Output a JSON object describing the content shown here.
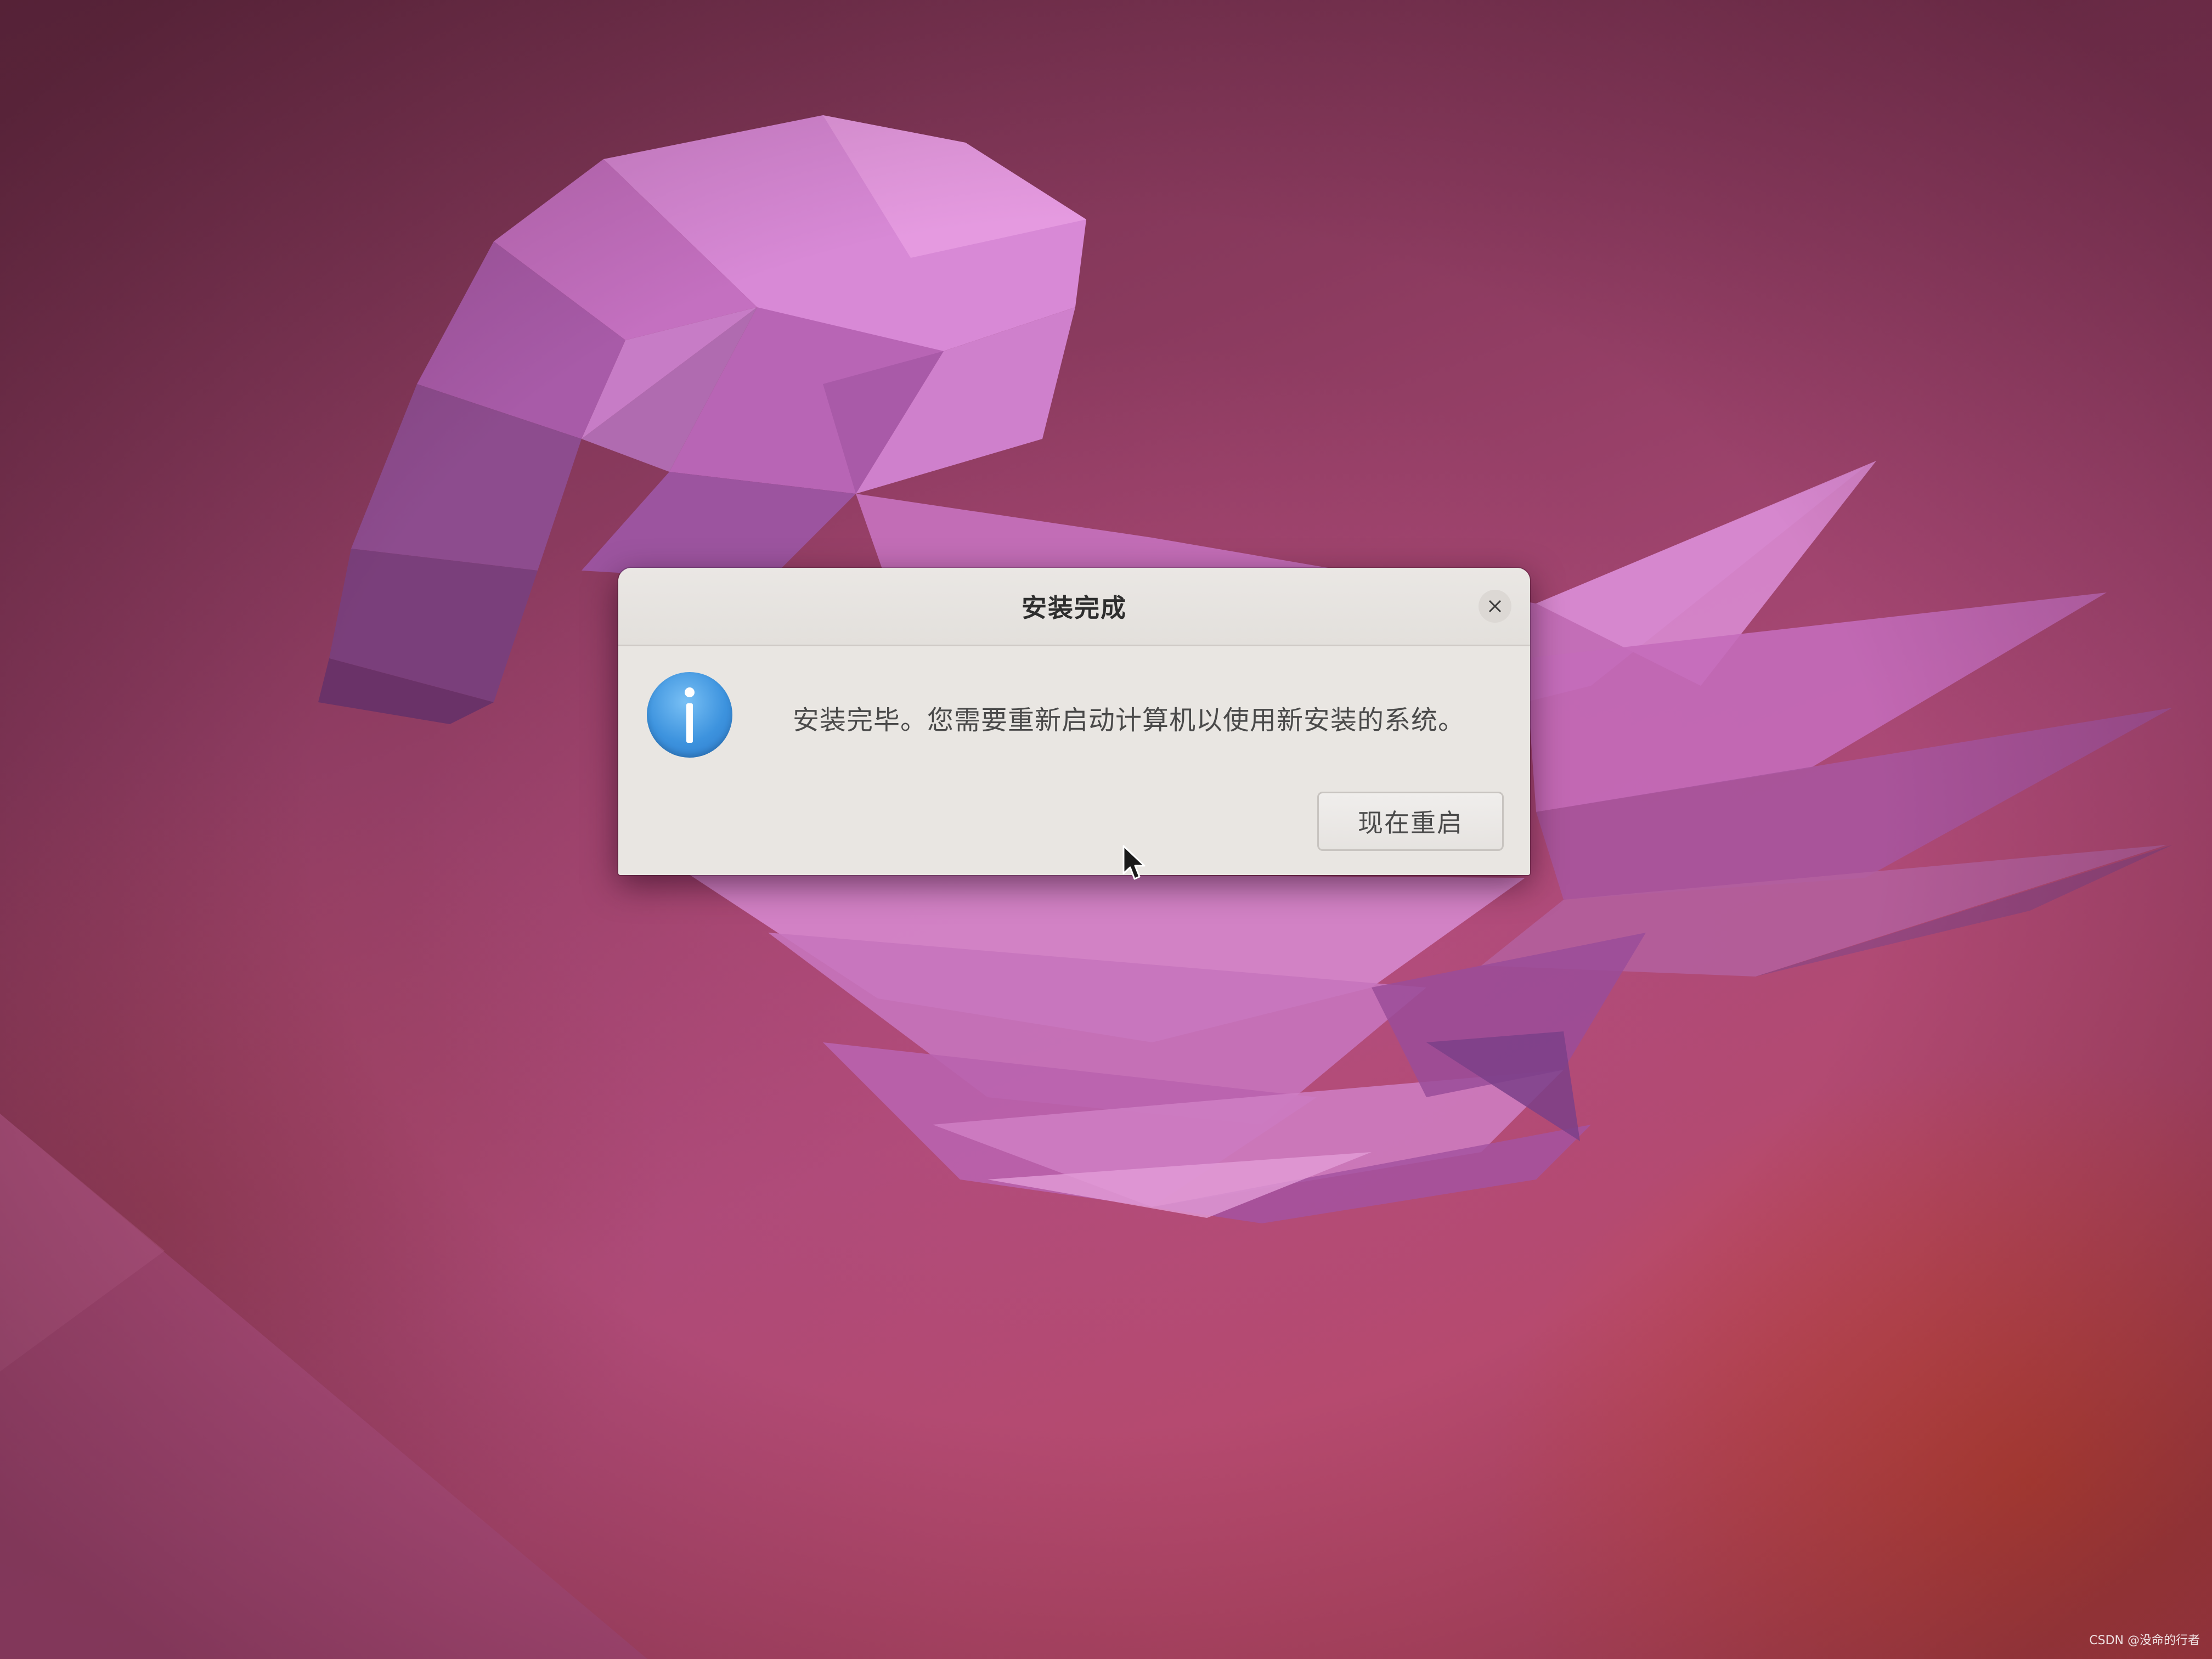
{
  "dialog": {
    "title": "安装完成",
    "message": "安装完毕。您需要重新启动计算机以使用新安装的系统。",
    "restart_label": "现在重启",
    "icons": {
      "info": "info-icon",
      "close": "close-icon"
    }
  },
  "desktop": {
    "wallpaper": "jellyfish-wallpaper",
    "cursor": "mouse-pointer-icon"
  },
  "watermark": "CSDN @没命的行者",
  "colors": {
    "dialog_bg": "#ebe8e5",
    "info_blue": "#3d93de",
    "wallpaper_base": "#9a3a64"
  }
}
